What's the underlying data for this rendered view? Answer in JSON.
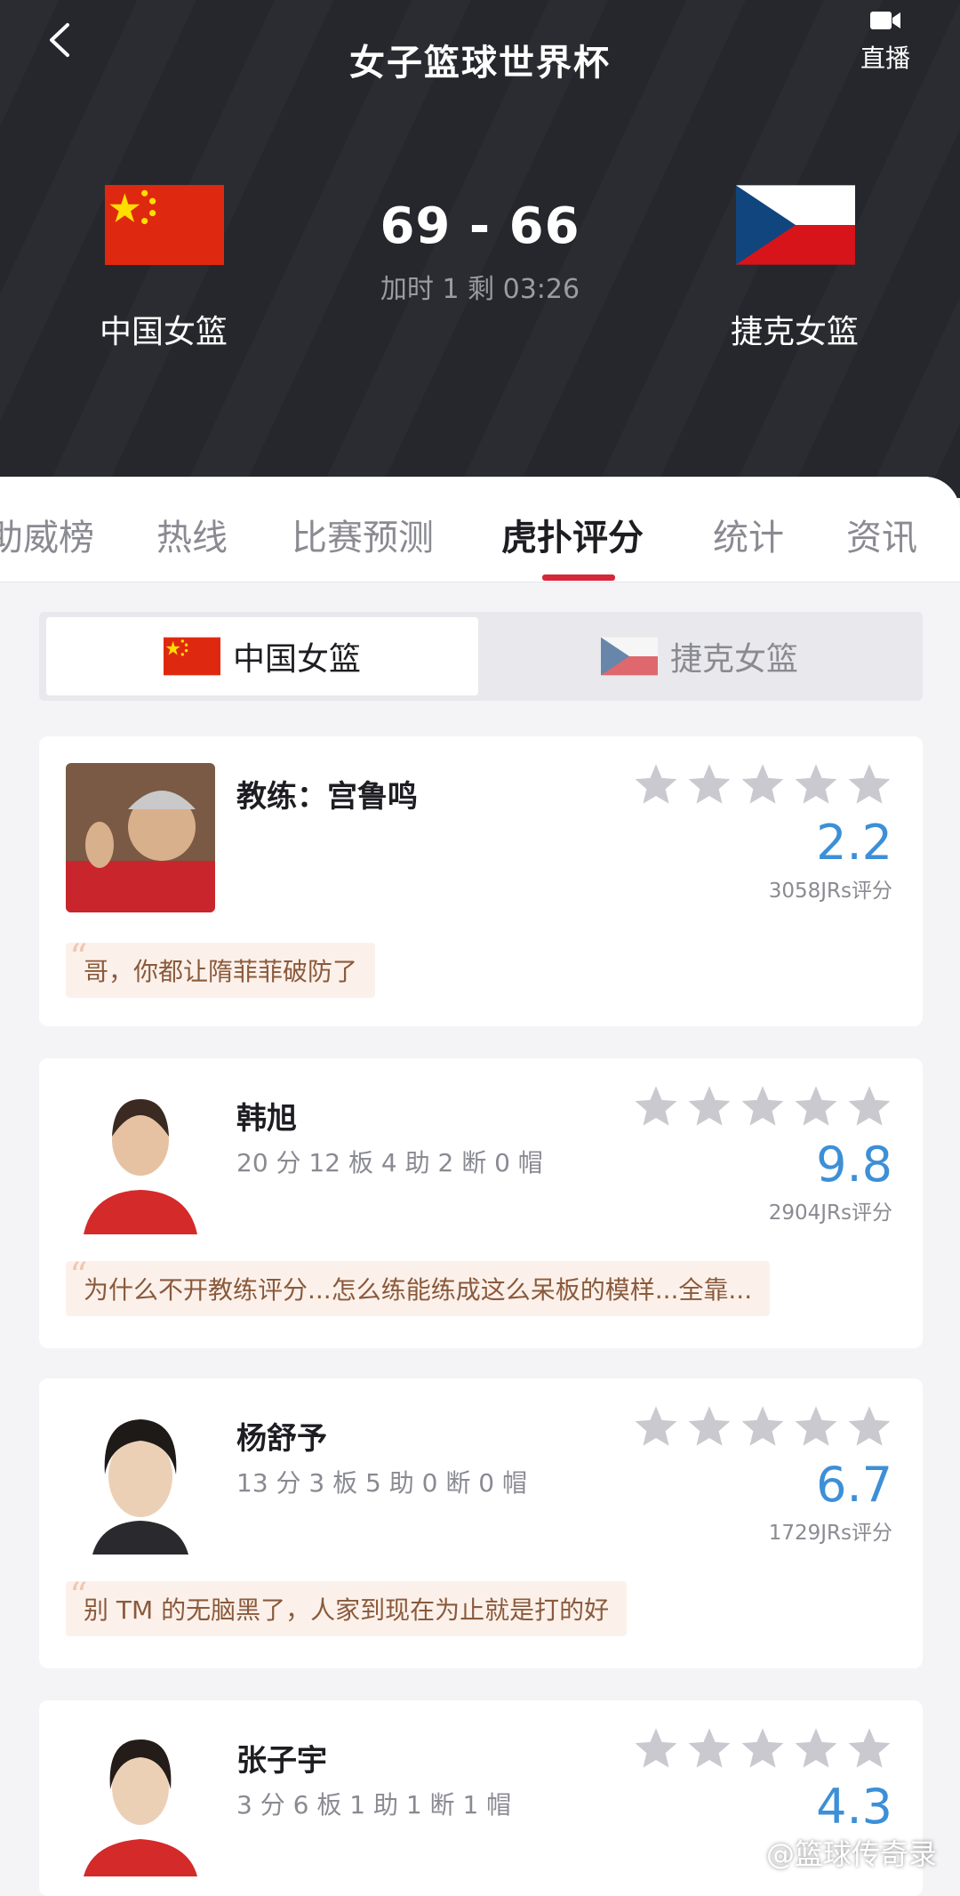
{
  "header": {
    "title": "女子篮球世界杯",
    "live_label": "直播",
    "home_team": "中国女篮",
    "away_team": "捷克女篮",
    "score": "69 - 66",
    "status": "加时 1 剩 03:26",
    "icons": {
      "back": "back-arrow-icon",
      "live": "video-camera-icon"
    }
  },
  "tabs": [
    "助威榜",
    "热线",
    "比赛预测",
    "虎扑评分",
    "统计",
    "资讯"
  ],
  "active_tab": "虎扑评分",
  "team_switch": {
    "left": "中国女篮",
    "right": "捷克女篮",
    "selected": "中国女篮"
  },
  "colors": {
    "accent_red": "#d4283a",
    "rating_blue": "#3d8fd6",
    "header_bg": "#26272c"
  },
  "players": [
    {
      "name": "教练：宫鲁鸣",
      "stats": "",
      "rating": "2.2",
      "votes": "3058JRs评分",
      "comment": "哥，你都让隋菲菲破防了"
    },
    {
      "name": "韩旭",
      "stats": "20 分 12 板 4 助 2 断 0 帽",
      "rating": "9.8",
      "votes": "2904JRs评分",
      "comment": "为什么不开教练评分...怎么练能练成这么呆板的模样...全靠..."
    },
    {
      "name": "杨舒予",
      "stats": "13 分 3 板 5 助 0 断 0 帽",
      "rating": "6.7",
      "votes": "1729JRs评分",
      "comment": "别 TM 的无脑黑了，人家到现在为止就是打的好"
    },
    {
      "name": "张子宇",
      "stats": "3 分 6 板 1 助 1 断 1 帽",
      "rating": "4.3",
      "votes": "",
      "comment": ""
    }
  ],
  "watermark": "@篮球传奇录"
}
